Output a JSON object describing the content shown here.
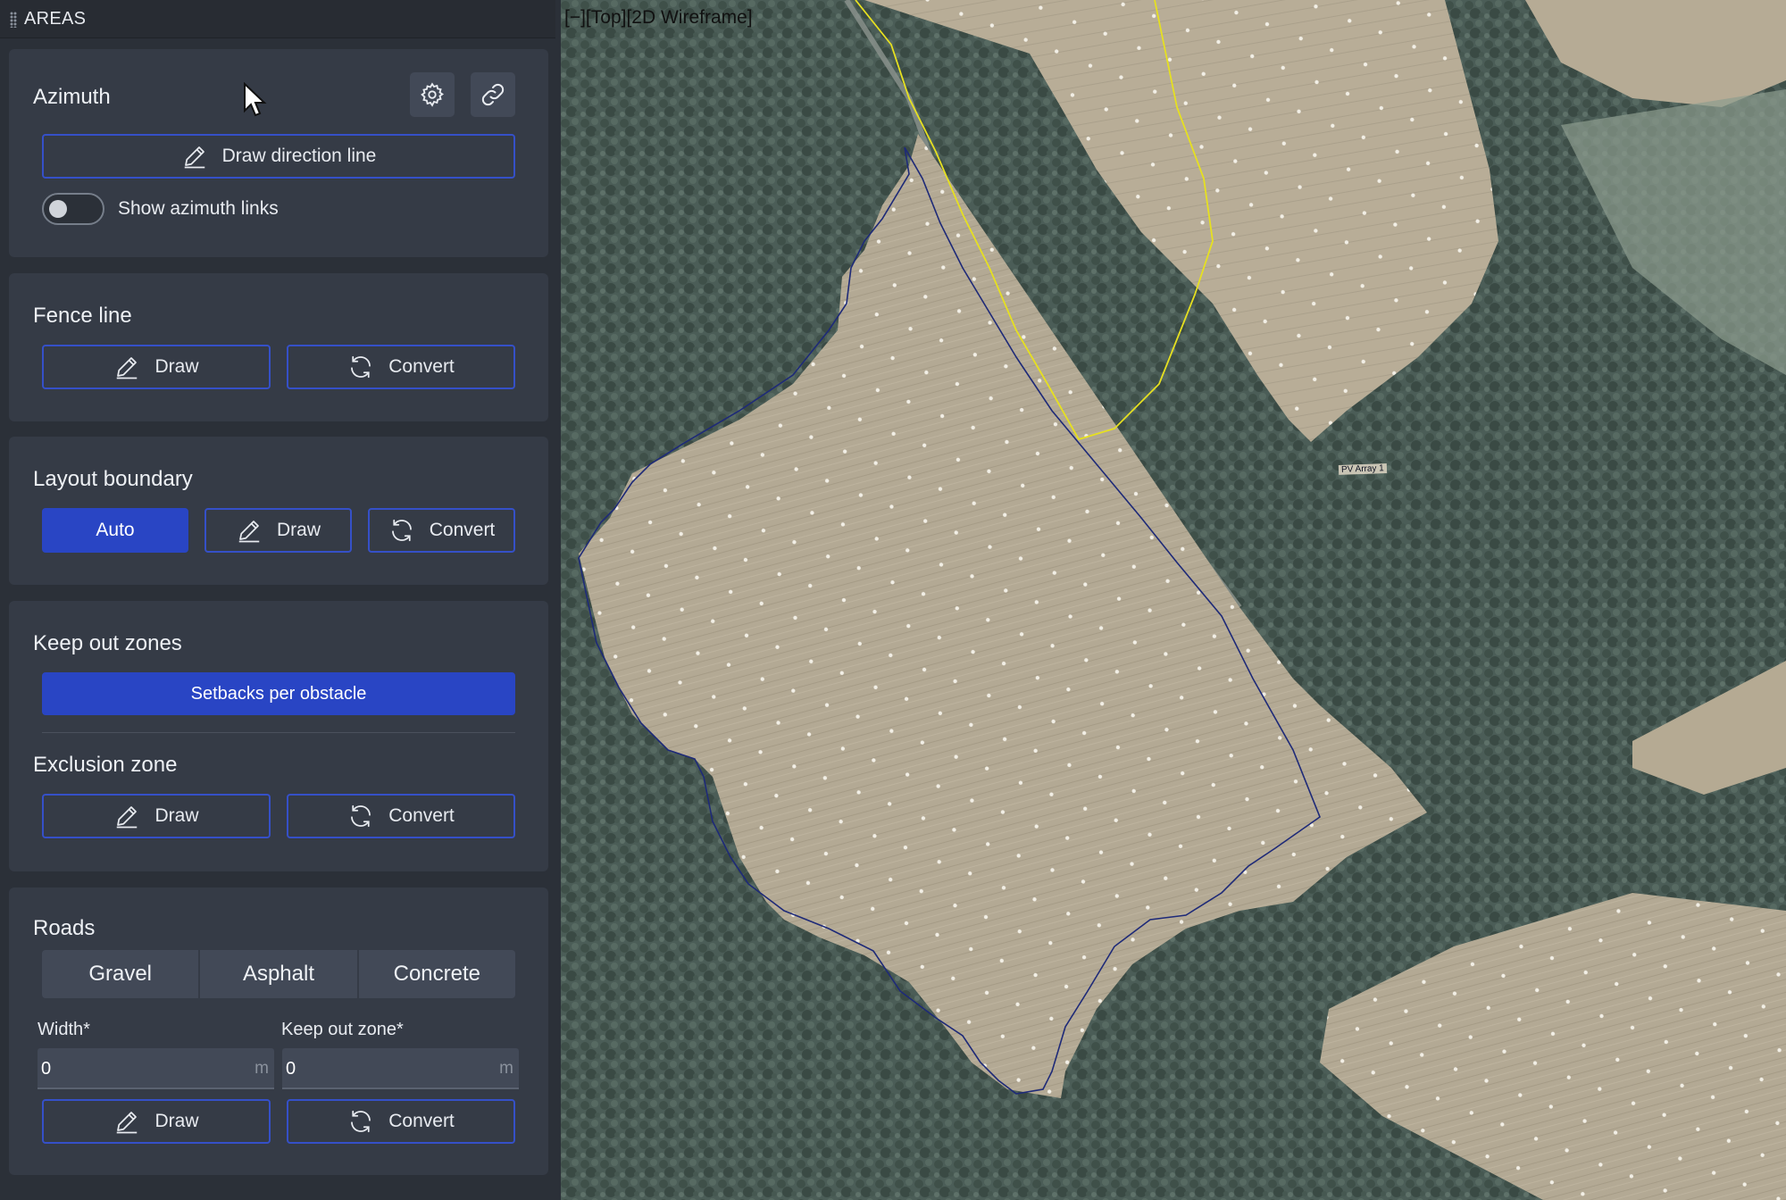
{
  "panel": {
    "title": "AREAS"
  },
  "azimuth": {
    "title": "Azimuth",
    "settings_icon": "gear-icon",
    "link_icon": "link-icon",
    "draw_direction_label": "Draw direction line",
    "toggle_label": "Show azimuth links",
    "toggle_on": false
  },
  "fence_line": {
    "title": "Fence line",
    "draw_label": "Draw",
    "convert_label": "Convert"
  },
  "layout_boundary": {
    "title": "Layout boundary",
    "auto_label": "Auto",
    "draw_label": "Draw",
    "convert_label": "Convert"
  },
  "keep_out_zones": {
    "title": "Keep out zones",
    "setbacks_label": "Setbacks per obstacle"
  },
  "exclusion_zone": {
    "title": "Exclusion zone",
    "draw_label": "Draw",
    "convert_label": "Convert"
  },
  "roads": {
    "title": "Roads",
    "types": [
      "Gravel",
      "Asphalt",
      "Concrete"
    ],
    "width_label": "Width*",
    "width_value": "0",
    "width_unit": "m",
    "keepout_label": "Keep out zone*",
    "keepout_value": "0",
    "keepout_unit": "m",
    "draw_label": "Draw",
    "convert_label": "Convert"
  },
  "viewport": {
    "title": "[−][Top][2D Wireframe]",
    "parcel_label": "PV Array 1"
  },
  "colors": {
    "accent": "#2945c4",
    "panel_bg": "#2b3038",
    "section_bg": "#353b46",
    "boundary_line": "#1e2a78",
    "fence_line": "#e6e020"
  }
}
